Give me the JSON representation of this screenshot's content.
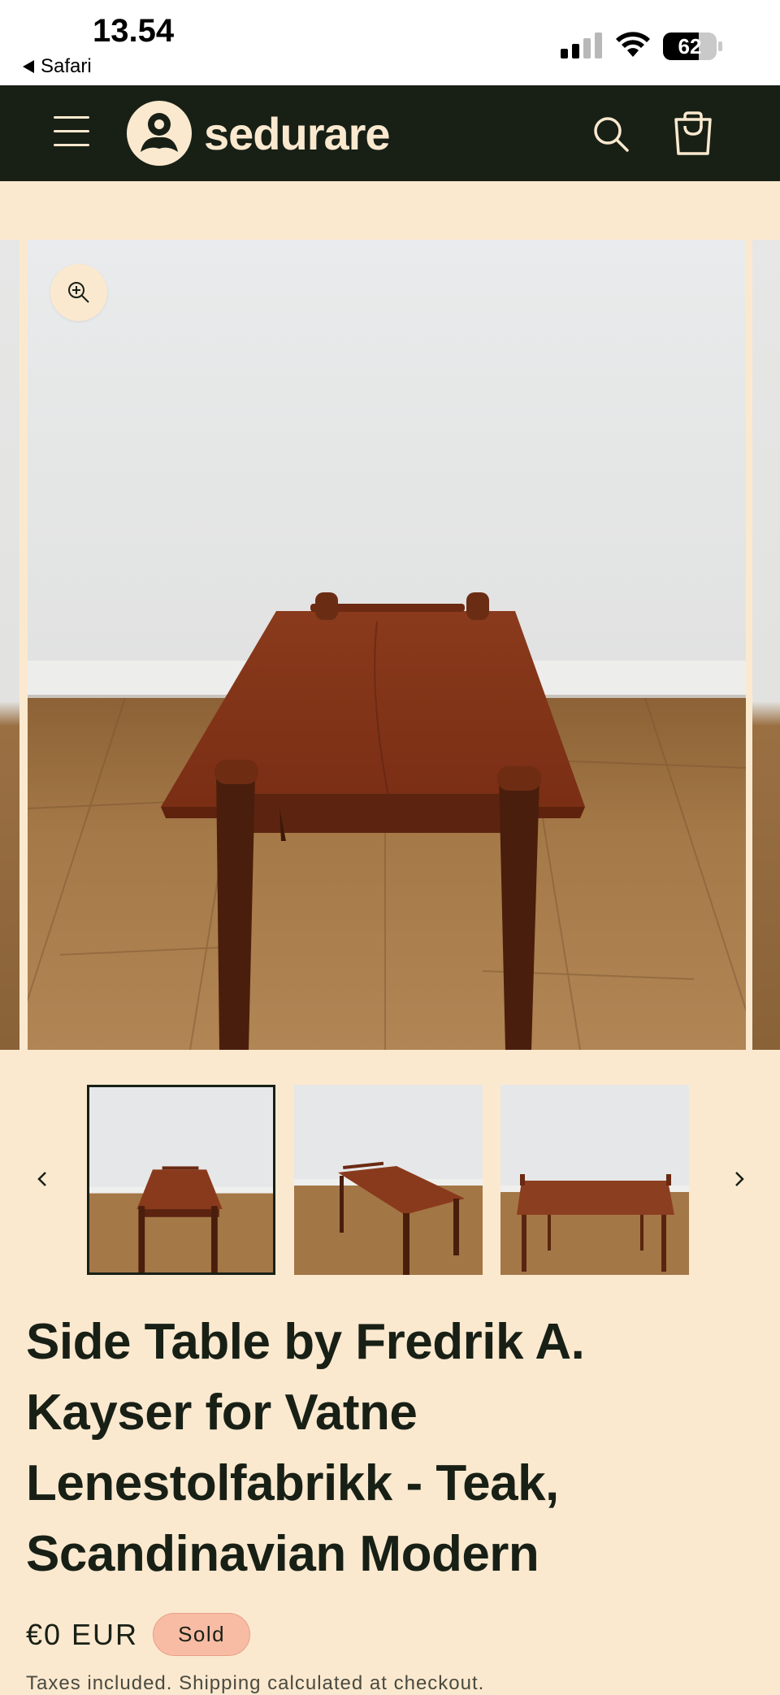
{
  "status_bar": {
    "time": "13.54",
    "back_app": "Safari",
    "battery": "62"
  },
  "header": {
    "brand": "sedurare"
  },
  "gallery": {
    "image_alt": "Teak side table with raised gallery rail on wooden floor"
  },
  "thumbnails": {
    "items": [
      {
        "view": "front",
        "selected": true
      },
      {
        "view": "angled",
        "selected": false
      },
      {
        "view": "top",
        "selected": false
      }
    ]
  },
  "product": {
    "title": "Side Table by Fredrik A. Kayser for Vatne Lenestolfabrikk - Teak, Scandinavian Modern",
    "price": "€0 EUR",
    "badge": "Sold",
    "tax_note": "Taxes included. Shipping calculated at checkout."
  },
  "colors": {
    "header_bg": "#182016",
    "page_bg": "#fbe9cf",
    "badge_bg": "#f8bca5",
    "teak": "#8a3c1e"
  }
}
